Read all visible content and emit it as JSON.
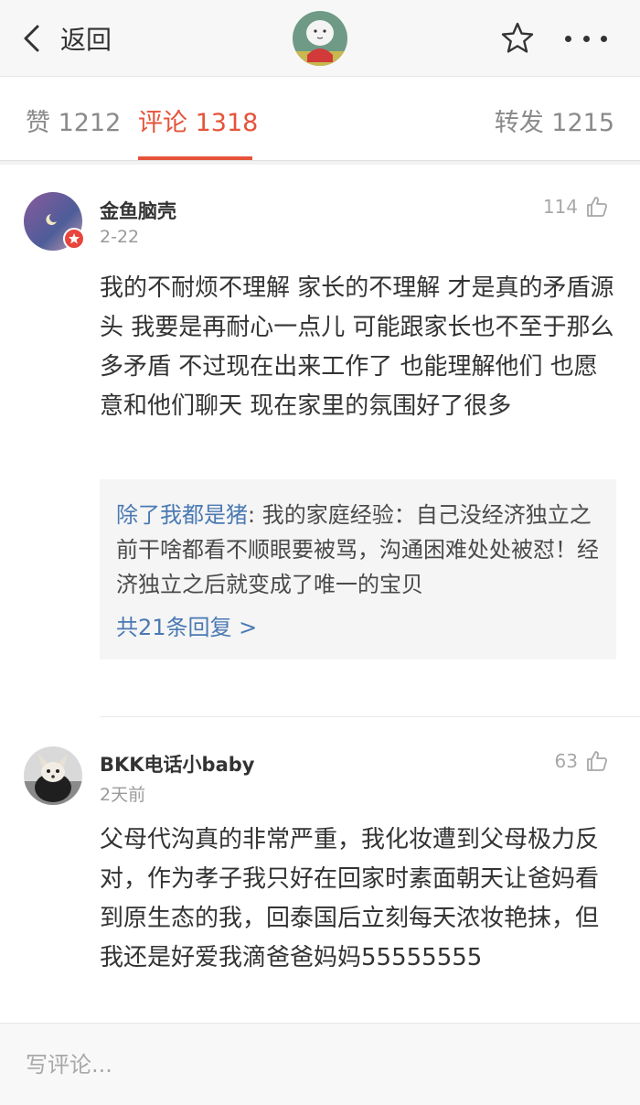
{
  "header": {
    "back_label": "返回"
  },
  "tabs": [
    {
      "label": "赞 1212"
    },
    {
      "label": "评论 1318"
    },
    {
      "label": "转发 1215"
    }
  ],
  "comments": [
    {
      "author": "金鱼脑壳",
      "time": "2-22",
      "likes": "114",
      "text": "我的不耐烦不理解 家长的不理解 才是真的矛盾源头 我要是再耐心一点儿 可能跟家长也不至于那么多矛盾 不过现在出来工作了 也能理解他们 也愿意和他们聊天 现在家里的氛围好了很多",
      "reply": {
        "user": "除了我都是猪",
        "text": ": 我的家庭经验：自己没经济独立之前干啥都看不顺眼要被骂，沟通困难处处被怼！经济独立之后就变成了唯一的宝贝",
        "more": "共21条回复 >"
      }
    },
    {
      "author": "BKK电话小baby",
      "time": "2天前",
      "likes": "63",
      "text": "父母代沟真的非常严重，我化妆遭到父母极力反对，作为孝子我只好在回家时素面朝天让爸妈看到原生态的我，回泰国后立刻每天浓妆艳抹，但我还是好爱我滴爸爸妈妈55555555"
    }
  ],
  "bottom": {
    "placeholder": "写评论..."
  },
  "colors": {
    "accent": "#e5533a",
    "link": "#4a79b3",
    "badge": "#e8453c"
  }
}
